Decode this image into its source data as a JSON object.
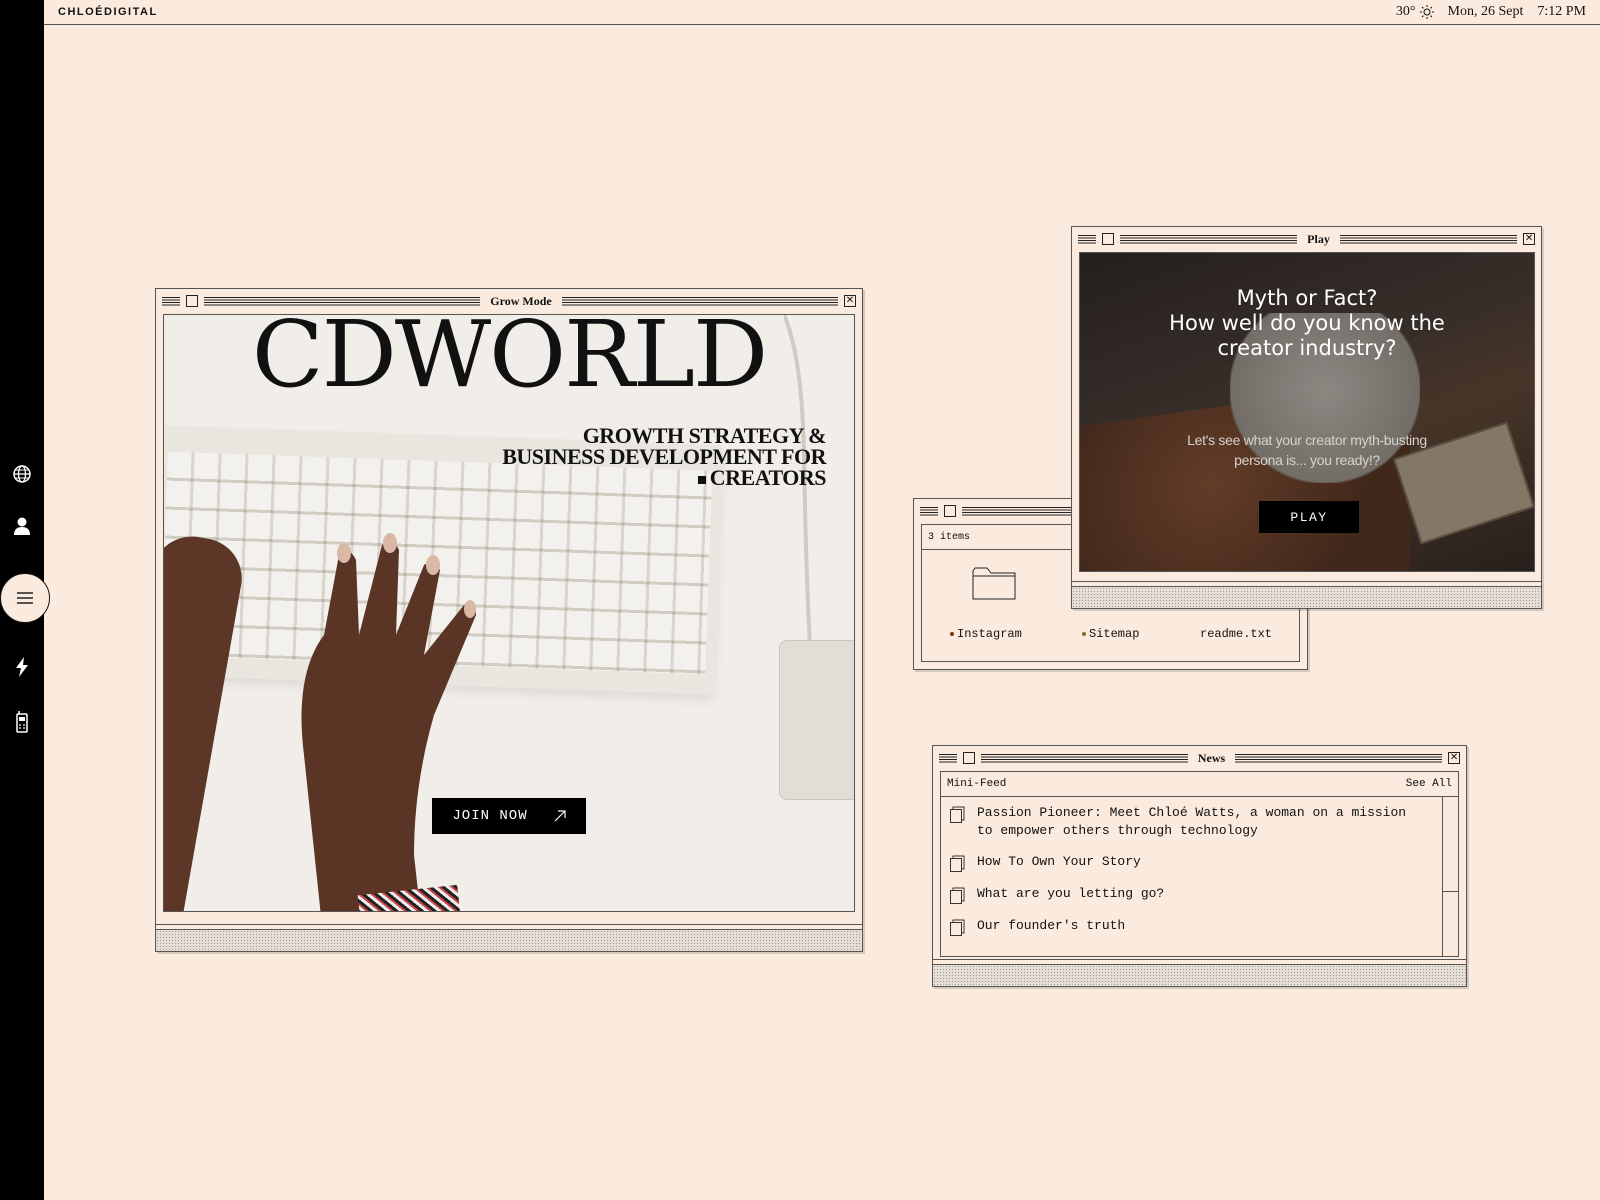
{
  "topbar": {
    "brand": "CHLOÉDIGITAL",
    "temperature": "30°",
    "weather_icon": "sun-icon",
    "date": "Mon, 26 Sept",
    "time": "7:12 PM"
  },
  "rail": {
    "items": [
      "globe-icon",
      "user-icon",
      "menu-icon",
      "lightning-icon",
      "phone-icon"
    ]
  },
  "grow_window": {
    "title": "Grow Mode",
    "logo": "CDWORLD",
    "tagline_line1": "GROWTH STRATEGY &",
    "tagline_line2": "BUSINESS DEVELOPMENT FOR",
    "tagline_line3": "CREATORS",
    "cta_label": "JOIN NOW",
    "cta_icon": "arrow-up-right-icon"
  },
  "items_window": {
    "count_label": "3 items",
    "files": [
      {
        "name": "Instagram"
      },
      {
        "name": "Sitemap"
      },
      {
        "name": "readme.txt"
      }
    ]
  },
  "play_window": {
    "title": "Play",
    "question_line1": "Myth or Fact?",
    "question_line2": "How well do you know the",
    "question_line3": "creator industry?",
    "sub_line1": "Let's see what your creator myth-busting",
    "sub_line2": "persona is... you ready!?",
    "button_label": "PLAY"
  },
  "news_window": {
    "title": "News",
    "feed_label": "Mini-Feed",
    "see_all": "See All",
    "items": [
      {
        "line1": "Passion Pioneer: Meet Chloé Watts, a woman on a mission",
        "line2": "to empower others through technology"
      },
      {
        "line1": "How To Own Your Story",
        "line2": ""
      },
      {
        "line1": "What are you letting go?",
        "line2": ""
      },
      {
        "line1": "Our founder's truth",
        "line2": ""
      }
    ]
  },
  "colors": {
    "background": "#fbebde",
    "rail": "#000000",
    "accent_dot": "#8b2d16"
  }
}
